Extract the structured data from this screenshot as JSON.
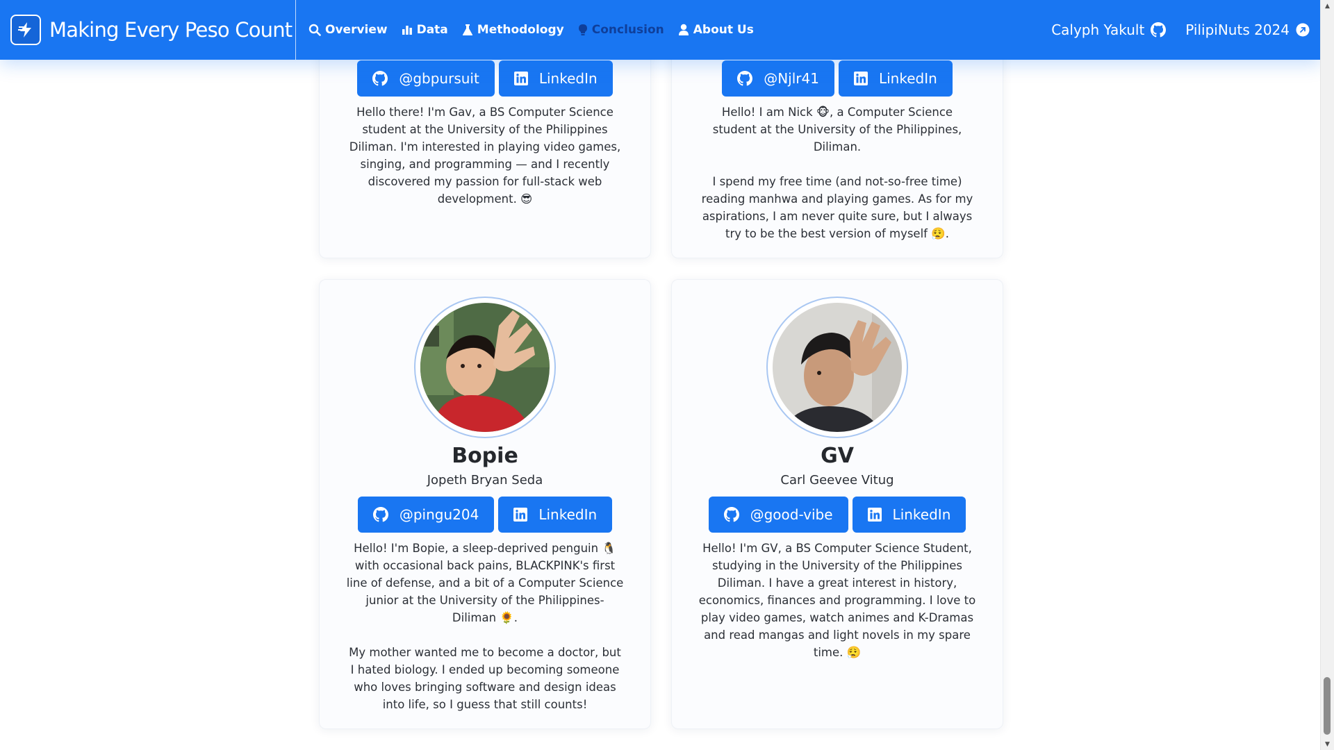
{
  "app": {
    "title": "Making Every Peso Count",
    "logo_icon": "app-logo-icon"
  },
  "nav": {
    "items": [
      {
        "label": "Overview",
        "icon": "search-icon"
      },
      {
        "label": "Data",
        "icon": "bar-chart-icon"
      },
      {
        "label": "Methodology",
        "icon": "flask-icon"
      },
      {
        "label": "Conclusion",
        "icon": "lightbulb-icon"
      },
      {
        "label": "About Us",
        "icon": "person-icon"
      }
    ],
    "right": [
      {
        "label": "Calyph Yakult",
        "icon": "github-icon"
      },
      {
        "label": "PilipiNuts 2024",
        "icon": "external-link-icon"
      }
    ]
  },
  "members": [
    {
      "github": "@gbpursuit",
      "linkedin": "LinkedIn",
      "bio": [
        "Hello there! I'm Gav, a BS Computer Science student at the University of the Philippines Diliman. I'm interested in playing video games, singing, and programming — and I recently discovered my passion for full-stack web development. 😎"
      ]
    },
    {
      "github": "@Njlr41",
      "linkedin": "LinkedIn",
      "bio": [
        "Hello! I am Nick 🐵, a Computer Science student at the University of the Philippines, Diliman.",
        "I spend my free time (and not-so-free time) reading manhwa and playing games. As for my aspirations, I am never quite sure, but I always try to be the best version of myself 😮‍💨."
      ]
    },
    {
      "nickname": "Bopie",
      "name": "Jopeth Bryan Seda",
      "github": "@pingu204",
      "linkedin": "LinkedIn",
      "bio": [
        "Hello! I'm Bopie, a sleep-deprived penguin 🐧 with occasional back pains, BLACKPINK's first line of defense, and a bit of a Computer Science junior at the University of the Philippines-Diliman 🌻.",
        "My mother wanted me to become a doctor, but I hated biology. I ended up becoming someone who loves bringing software and design ideas into life, so I guess that still counts!"
      ]
    },
    {
      "nickname": "GV",
      "name": "Carl Geevee Vitug",
      "github": "@good-vibe",
      "linkedin": "LinkedIn",
      "bio": [
        "Hello! I'm GV, a BS Computer Science Student, studying in the University of the Philippines Diliman. I have a great interest in history, economics, finances and programming. I love to play video games, watch animes and K-Dramas and read mangas and light novels in my spare time. 😮‍💨"
      ]
    }
  ],
  "colors": {
    "navbar": "#1976f2",
    "button": "#1976f2",
    "nav_active_muted": "#0f3f9a",
    "card_bg": "#fbfcfe"
  }
}
